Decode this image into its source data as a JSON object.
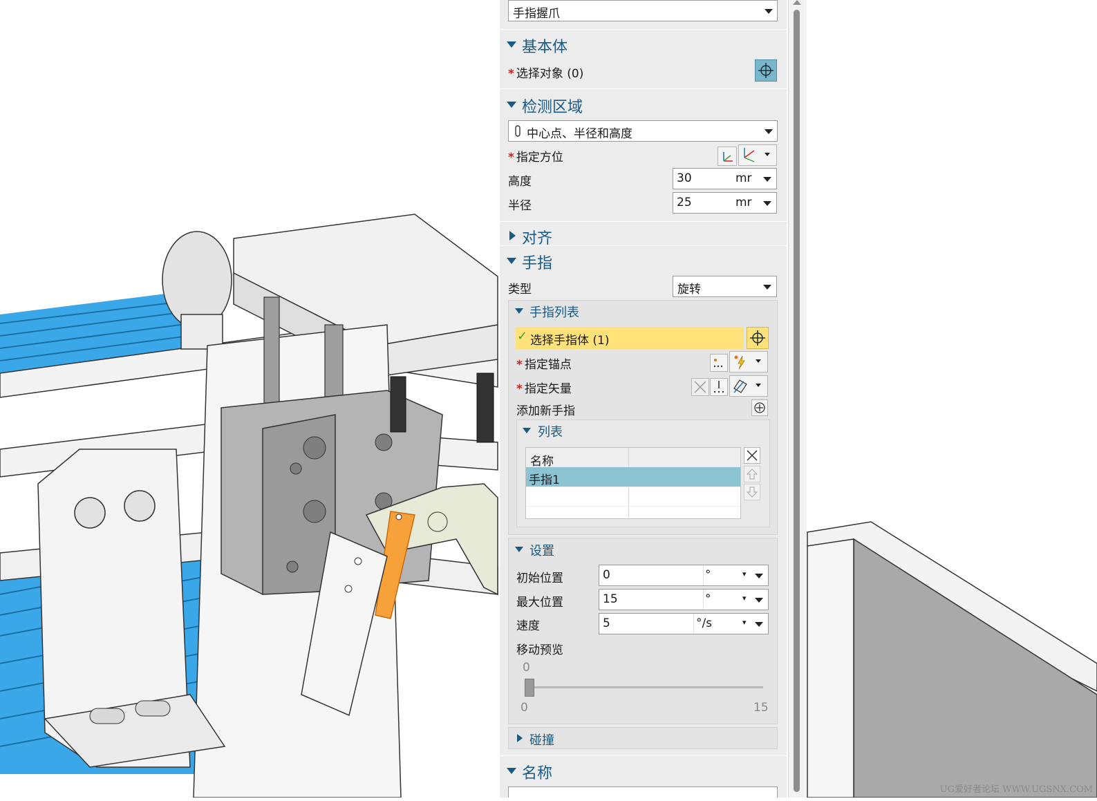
{
  "panel": {
    "top_dropdown": "手指握爪",
    "sections": {
      "basic_body": {
        "title": "基本体",
        "select_label": "选择对象 (0)"
      },
      "detection": {
        "title": "检测区域",
        "method": "中心点、半径和高度",
        "orientation_label": "指定方位",
        "height": {
          "label": "高度",
          "value": "30",
          "unit": "mr"
        },
        "radius": {
          "label": "半径",
          "value": "25",
          "unit": "mr"
        }
      },
      "align": {
        "title": "对齐"
      },
      "finger": {
        "title": "手指",
        "type_label": "类型",
        "type_value": "旋转",
        "finger_list": {
          "title": "手指列表",
          "select_body": "选择手指体 (1)",
          "anchor_label": "指定锚点",
          "vector_label": "指定矢量",
          "add_label": "添加新手指",
          "list": {
            "title": "列表",
            "header": "名称",
            "rows": [
              "手指1"
            ]
          }
        },
        "settings": {
          "title": "设置",
          "initial": {
            "label": "初始位置",
            "value": "0",
            "unit": "°"
          },
          "max": {
            "label": "最大位置",
            "value": "15",
            "unit": "°"
          },
          "speed": {
            "label": "速度",
            "value": "5",
            "unit": "°/s"
          },
          "preview_label": "移动预览",
          "slider_value": "0",
          "slider_min": "0",
          "slider_max": "15",
          "slider_fraction": 0
        },
        "collision": {
          "title": "碰撞"
        }
      },
      "name": {
        "title": "名称"
      }
    }
  },
  "watermark": "UG爱好者论坛 WWW.UGSNX.COM",
  "colors": {
    "accent": "#1a5a86",
    "required_star": "#e01a1a",
    "highlight_row": "#ffe37a",
    "selected_row": "#8cc3d3",
    "conveyor_blue": "#3aa8e8",
    "finger_orange": "#f7a13a"
  }
}
